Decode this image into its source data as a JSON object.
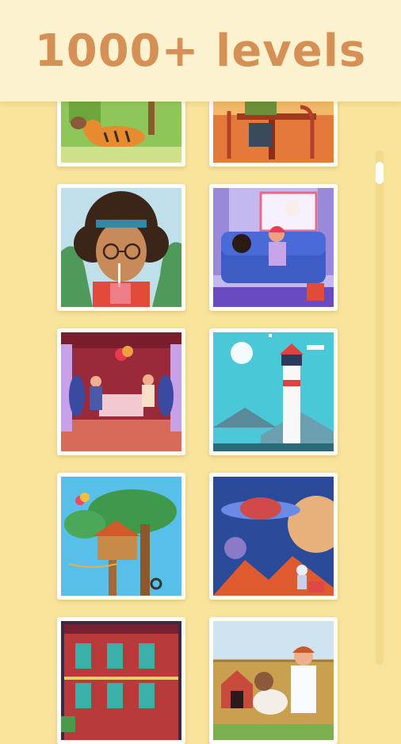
{
  "header": {
    "title": "1000+ levels"
  },
  "levels": [
    {
      "name": "tiger-in-park"
    },
    {
      "name": "cafe-table"
    },
    {
      "name": "girl-with-drink"
    },
    {
      "name": "girl-and-dog-on-sofa"
    },
    {
      "name": "romantic-dinner"
    },
    {
      "name": "lighthouse"
    },
    {
      "name": "treehouse"
    },
    {
      "name": "space-scene"
    },
    {
      "name": "red-apartment-building"
    },
    {
      "name": "vet-with-dog"
    }
  ],
  "colors": {
    "background": "#f8e39a",
    "header": "#fdf2d0",
    "title": "#d49055"
  }
}
